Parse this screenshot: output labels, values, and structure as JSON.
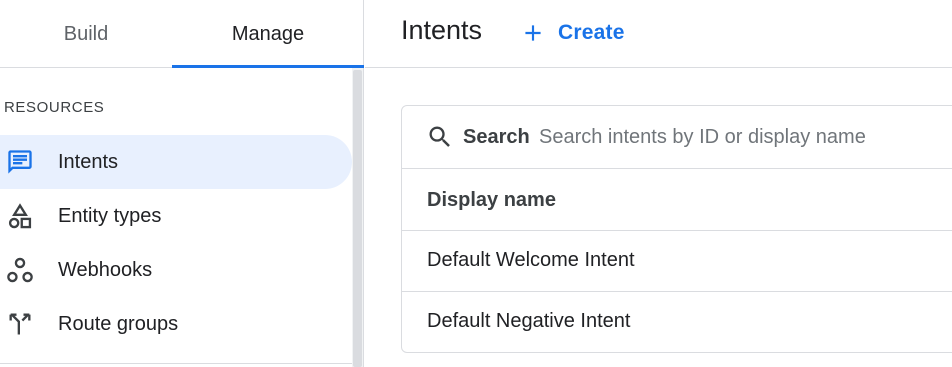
{
  "tabs": {
    "build": "Build",
    "manage": "Manage"
  },
  "sidebar": {
    "section_label": "RESOURCES",
    "items": [
      {
        "label": "Intents",
        "icon": "intents-icon",
        "active": true
      },
      {
        "label": "Entity types",
        "icon": "entity-types-icon"
      },
      {
        "label": "Webhooks",
        "icon": "webhooks-icon"
      },
      {
        "label": "Route groups",
        "icon": "route-groups-icon"
      }
    ]
  },
  "header": {
    "title": "Intents",
    "create_label": "Create"
  },
  "search": {
    "label": "Search",
    "placeholder": "Search intents by ID or display name",
    "value": ""
  },
  "table": {
    "columns": [
      "Display name"
    ],
    "rows": [
      {
        "display_name": "Default Welcome Intent"
      },
      {
        "display_name": "Default Negative Intent"
      }
    ]
  },
  "colors": {
    "accent": "#1a73e8",
    "active_bg": "#e8f0fe",
    "divider": "#dadce0"
  }
}
